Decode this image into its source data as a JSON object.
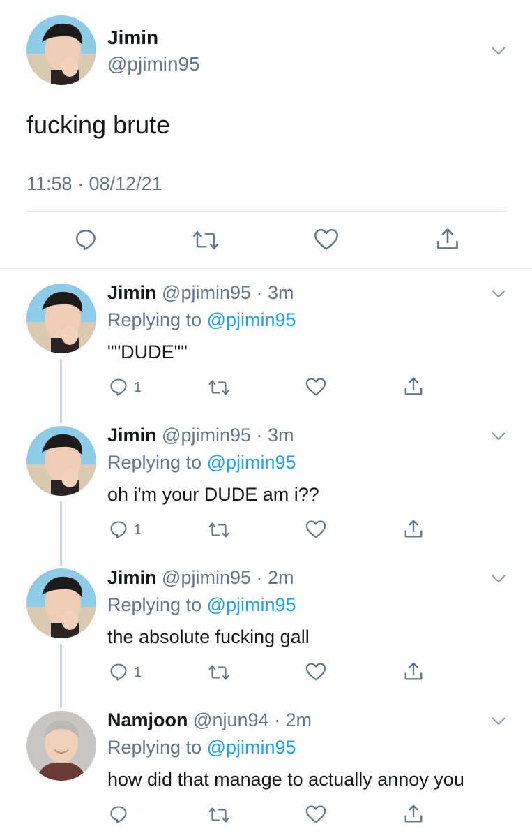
{
  "main_tweet": {
    "name": "Jimin",
    "handle": "@pjimin95",
    "text": "fucking brute",
    "timestamp": "11:58 · 08/12/21"
  },
  "replies": [
    {
      "name": "Jimin",
      "handle": "@pjimin95",
      "time": "3m",
      "replying_label": "Replying to",
      "mention": "@pjimin95",
      "text": "\"\"DUDE\"\"",
      "reply_count": "1"
    },
    {
      "name": "Jimin",
      "handle": "@pjimin95",
      "time": "3m",
      "replying_label": "Replying to",
      "mention": "@pjimin95",
      "text": "oh i'm your DUDE am i??",
      "reply_count": "1"
    },
    {
      "name": "Jimin",
      "handle": "@pjimin95",
      "time": "2m",
      "replying_label": "Replying to",
      "mention": "@pjimin95",
      "text": "the absolute fucking gall",
      "reply_count": "1"
    },
    {
      "name": "Namjoon",
      "handle": "@njun94",
      "time": "2m",
      "replying_label": "Replying to",
      "mention": "@pjimin95",
      "text": "how did that manage to actually annoy you",
      "reply_count": ""
    }
  ],
  "colors": {
    "text": "#14171a",
    "secondary": "#657786",
    "accent": "#1da1f2",
    "divider": "#e1e8ed",
    "thread": "#ccd6dd"
  },
  "icons": [
    "reply-icon",
    "retweet-icon",
    "like-icon",
    "share-icon",
    "chevron-down-icon"
  ]
}
